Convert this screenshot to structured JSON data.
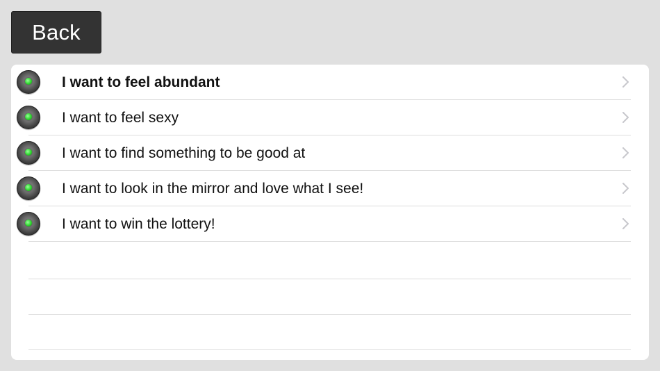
{
  "header": {
    "back_label": "Back"
  },
  "list": {
    "items": [
      {
        "label": "I want to feel abundant",
        "status": "green",
        "selected": true
      },
      {
        "label": "I want to feel sexy",
        "status": "green",
        "selected": false
      },
      {
        "label": "I want to find something to be good at",
        "status": "green",
        "selected": false
      },
      {
        "label": "I want to look in the mirror and love what I see!",
        "status": "green",
        "selected": false
      },
      {
        "label": "I want to win the lottery!",
        "status": "green",
        "selected": false
      }
    ],
    "icons": {
      "status": "status-light-icon",
      "disclosure": "chevron-right-icon"
    }
  },
  "colors": {
    "background": "#e0e0e0",
    "button": "#333333",
    "status_light": "#2bd62b",
    "chevron": "#c7c7cc",
    "separator": "#dcdcdc"
  }
}
